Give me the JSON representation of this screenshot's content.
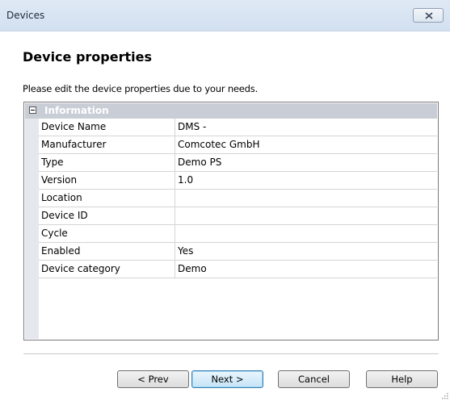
{
  "window": {
    "title": "Devices"
  },
  "dialog": {
    "heading": "Device properties",
    "instruction": "Please edit the device properties due to your needs."
  },
  "grid": {
    "category": "Information",
    "rows": [
      {
        "name": "Device Name",
        "value": "DMS -"
      },
      {
        "name": "Manufacturer",
        "value": "Comcotec GmbH"
      },
      {
        "name": "Type",
        "value": "Demo PS"
      },
      {
        "name": "Version",
        "value": "1.0"
      },
      {
        "name": "Location",
        "value": ""
      },
      {
        "name": "Device ID",
        "value": ""
      },
      {
        "name": "Cycle",
        "value": ""
      },
      {
        "name": "Enabled",
        "value": "Yes"
      },
      {
        "name": "Device category",
        "value": "Demo"
      }
    ]
  },
  "buttons": {
    "prev": "< Prev",
    "next": "Next >",
    "cancel": "Cancel",
    "help": "Help"
  },
  "icons": {
    "close": "close-icon",
    "collapse": "collapse-icon",
    "resize_grip": "resize-grip-icon"
  },
  "colors": {
    "category_header": "#c8cdd6",
    "titlebar": "#dfe9f5",
    "default_button_border": "#3c7fb1"
  }
}
